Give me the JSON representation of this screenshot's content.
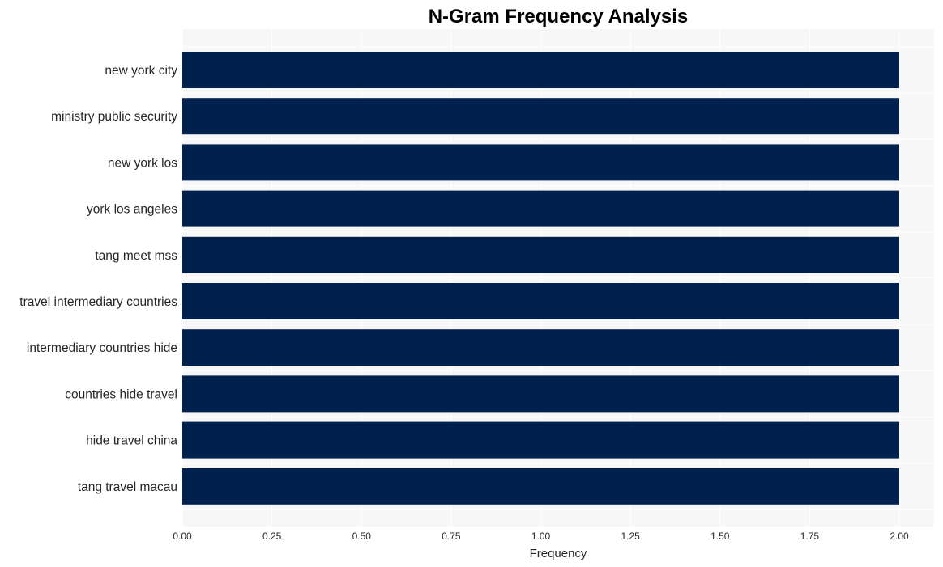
{
  "chart_data": {
    "type": "bar",
    "orientation": "horizontal",
    "title": "N-Gram Frequency Analysis",
    "xlabel": "Frequency",
    "ylabel": "",
    "categories": [
      "new york city",
      "ministry public security",
      "new york los",
      "york los angeles",
      "tang meet mss",
      "travel intermediary countries",
      "intermediary countries hide",
      "countries hide travel",
      "hide travel china",
      "tang travel macau"
    ],
    "values": [
      2,
      2,
      2,
      2,
      2,
      2,
      2,
      2,
      2,
      2
    ],
    "xlim": [
      0,
      2.2
    ],
    "xticks": [
      0.0,
      0.25,
      0.5,
      0.75,
      1.0,
      1.25,
      1.5,
      1.75,
      2.0
    ],
    "xtick_labels": [
      "0.00",
      "0.25",
      "0.50",
      "0.75",
      "1.00",
      "1.25",
      "1.50",
      "1.75",
      "2.00"
    ],
    "grid": true,
    "bar_color": "#00204e",
    "plot_background": "#f7f7f7",
    "grid_color": "#ffffff"
  }
}
